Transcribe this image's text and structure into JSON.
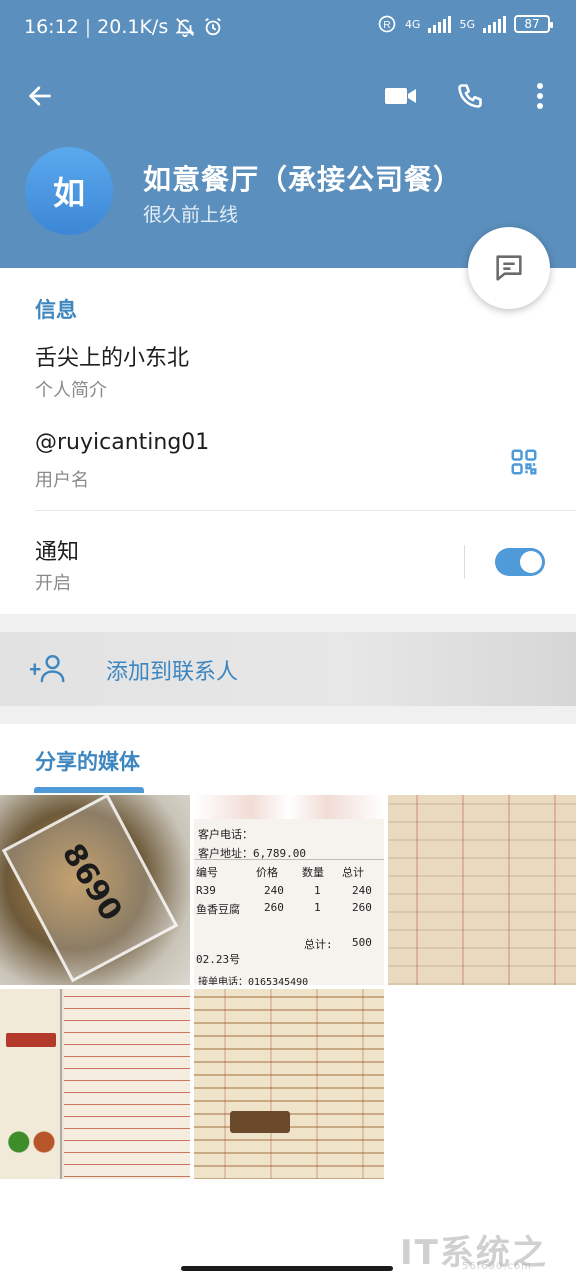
{
  "status_bar": {
    "time": "16:12",
    "speed": "20.1K/s",
    "net1": "4G",
    "net2": "5G",
    "battery": "87"
  },
  "header": {
    "avatar_letter": "如",
    "title": "如意餐厅（承接公司餐）",
    "subtitle": "很久前上线"
  },
  "info": {
    "section_title": "信息",
    "bio": "舌尖上的小东北",
    "bio_label": "个人简介",
    "username": "@ruyicanting01",
    "username_label": "用户名",
    "notify": "通知",
    "notify_state": "开启"
  },
  "add_contact": {
    "label": "添加到联系人"
  },
  "media": {
    "section_title": "分享的媒体",
    "receipt": {
      "phone": "客户电话：",
      "address": "客户地址：6,789.00",
      "col_no": "编号",
      "col_price": "价格",
      "col_qty": "数量",
      "col_total": "总计",
      "row1_no": "R39",
      "row1_price": "240",
      "row1_qty": "1",
      "row1_total": "240",
      "row2_no": "鱼香豆腐",
      "row2_price": "260",
      "row2_qty": "1",
      "row2_total": "260",
      "sum_label": "总计:",
      "sum_value": "500",
      "date": "02.23号",
      "footer": "接单电话：0165345490"
    },
    "bag_text": "8690"
  },
  "watermark": {
    "text": "IT系统之家",
    "url": "56f690.com"
  },
  "colors": {
    "header": "#5b8fbd",
    "accent": "#3e86bf",
    "toggle": "#4f9ad8"
  }
}
